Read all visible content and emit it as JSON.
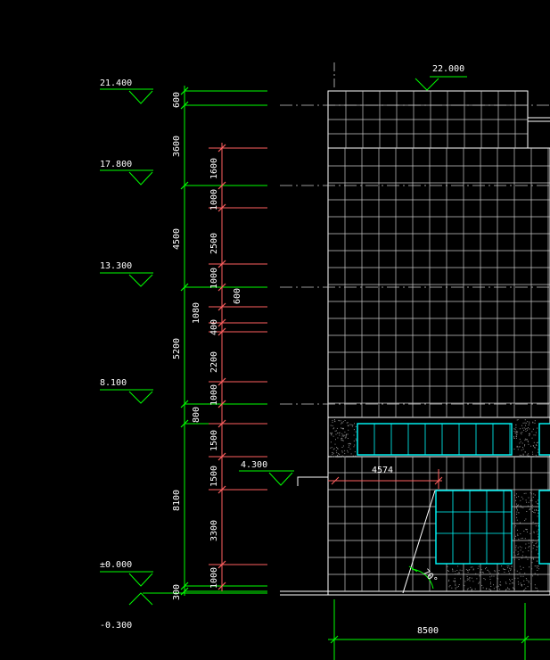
{
  "elevations": {
    "e21400": "21.400",
    "e17800": "17.800",
    "e13300": "13.300",
    "e8100": "8.100",
    "e4300": "4.300",
    "e0000": "±0.000",
    "em0300": "-0.300",
    "e22000": "22.000"
  },
  "dims_outer": {
    "d600": "600",
    "d3600": "3600",
    "d4500": "4500",
    "d5200": "5200",
    "d800": "800",
    "d8100": "8100",
    "d300": "300"
  },
  "dims_inner": {
    "d1600": "1600",
    "d1000a": "1000",
    "d2500": "2500",
    "d1000b": "1000",
    "d400": "400",
    "d2200": "2200",
    "d1000c": "1000",
    "d1500a": "1500",
    "d1500b": "1500",
    "d3300": "3300",
    "d1000d": "1000"
  },
  "dims_misc": {
    "d1080": "1080",
    "d600b": "600",
    "d4574": "4574",
    "d8500": "8500",
    "angle": "70°"
  },
  "colors": {
    "dim_green": "#00ff00",
    "dim_red": "#ff6060",
    "facade_white": "#ffffff",
    "glass_cyan": "#00ffff",
    "center_line": "#cccccc"
  }
}
